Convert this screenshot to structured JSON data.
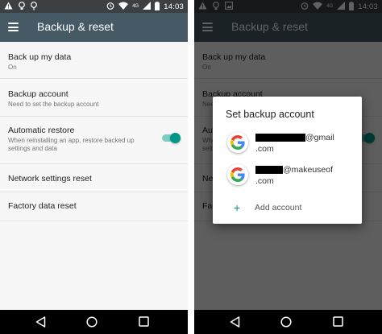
{
  "status_bar": {
    "time": "14:03",
    "network": "4G"
  },
  "app_bar": {
    "title": "Backup & reset"
  },
  "settings": [
    {
      "title": "Back up my data",
      "summary": "On"
    },
    {
      "title": "Backup account",
      "summary": "Need to set the backup account"
    },
    {
      "title": "Automatic restore",
      "summary": "When reinstalling an app, restore backed up settings and data",
      "toggle_on": true
    },
    {
      "title": "Network settings reset",
      "summary": ""
    },
    {
      "title": "Factory data reset",
      "summary": ""
    }
  ],
  "dialog": {
    "title": "Set backup account",
    "accounts": [
      {
        "domain": "@gmail",
        "tld": ".com"
      },
      {
        "domain": "@makeuseof",
        "tld": ".com"
      }
    ],
    "add_account_label": "Add account"
  },
  "colors": {
    "app_bar": "#455a64",
    "status_bar": "#3c4043",
    "accent": "#009688",
    "scrim": "rgba(0,0,0,0.62)"
  },
  "icons": [
    "menu-icon",
    "google-icon",
    "plus-icon",
    "back-icon",
    "home-icon",
    "recents-icon",
    "wifi-icon",
    "signal-icon",
    "battery-icon",
    "warning-icon"
  ]
}
